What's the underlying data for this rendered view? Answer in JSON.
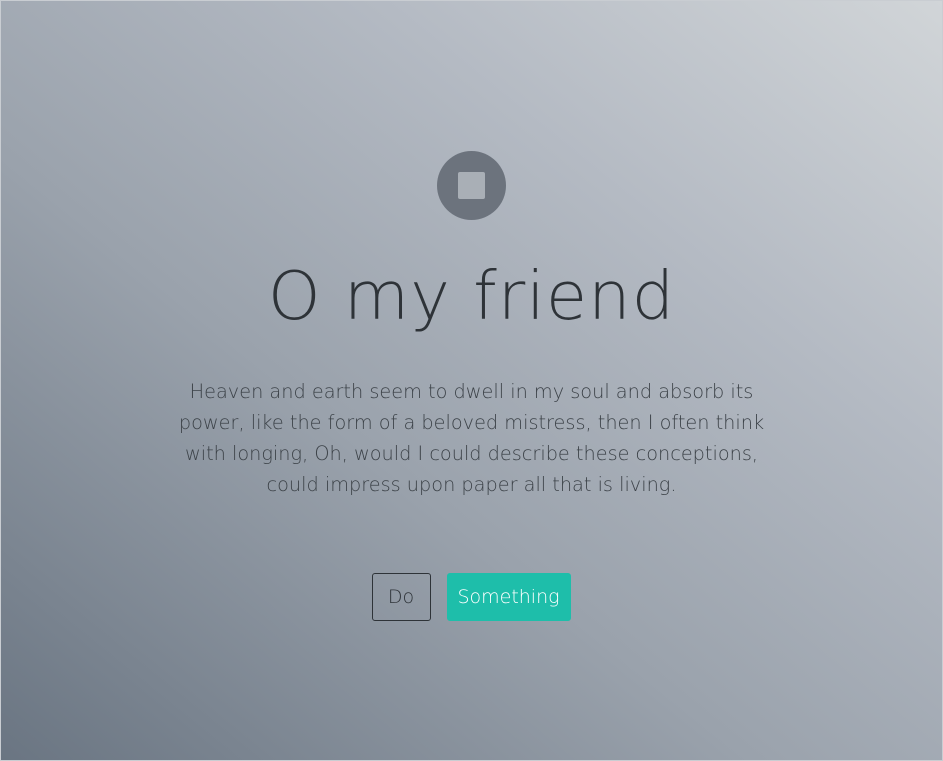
{
  "hero": {
    "logo_icon": "stop-square-icon",
    "title": "O my friend",
    "paragraph": "Heaven and earth seem to dwell in my soul and absorb its power, like the form of a beloved mistress, then I often think with longing, Oh, would I could describe these conceptions, could impress upon paper all that is living."
  },
  "buttons": {
    "secondary_label": "Do",
    "primary_label": "Something"
  },
  "colors": {
    "accent": "#1ebeaa",
    "text": "#2e3338",
    "logo": "#6c737d"
  }
}
